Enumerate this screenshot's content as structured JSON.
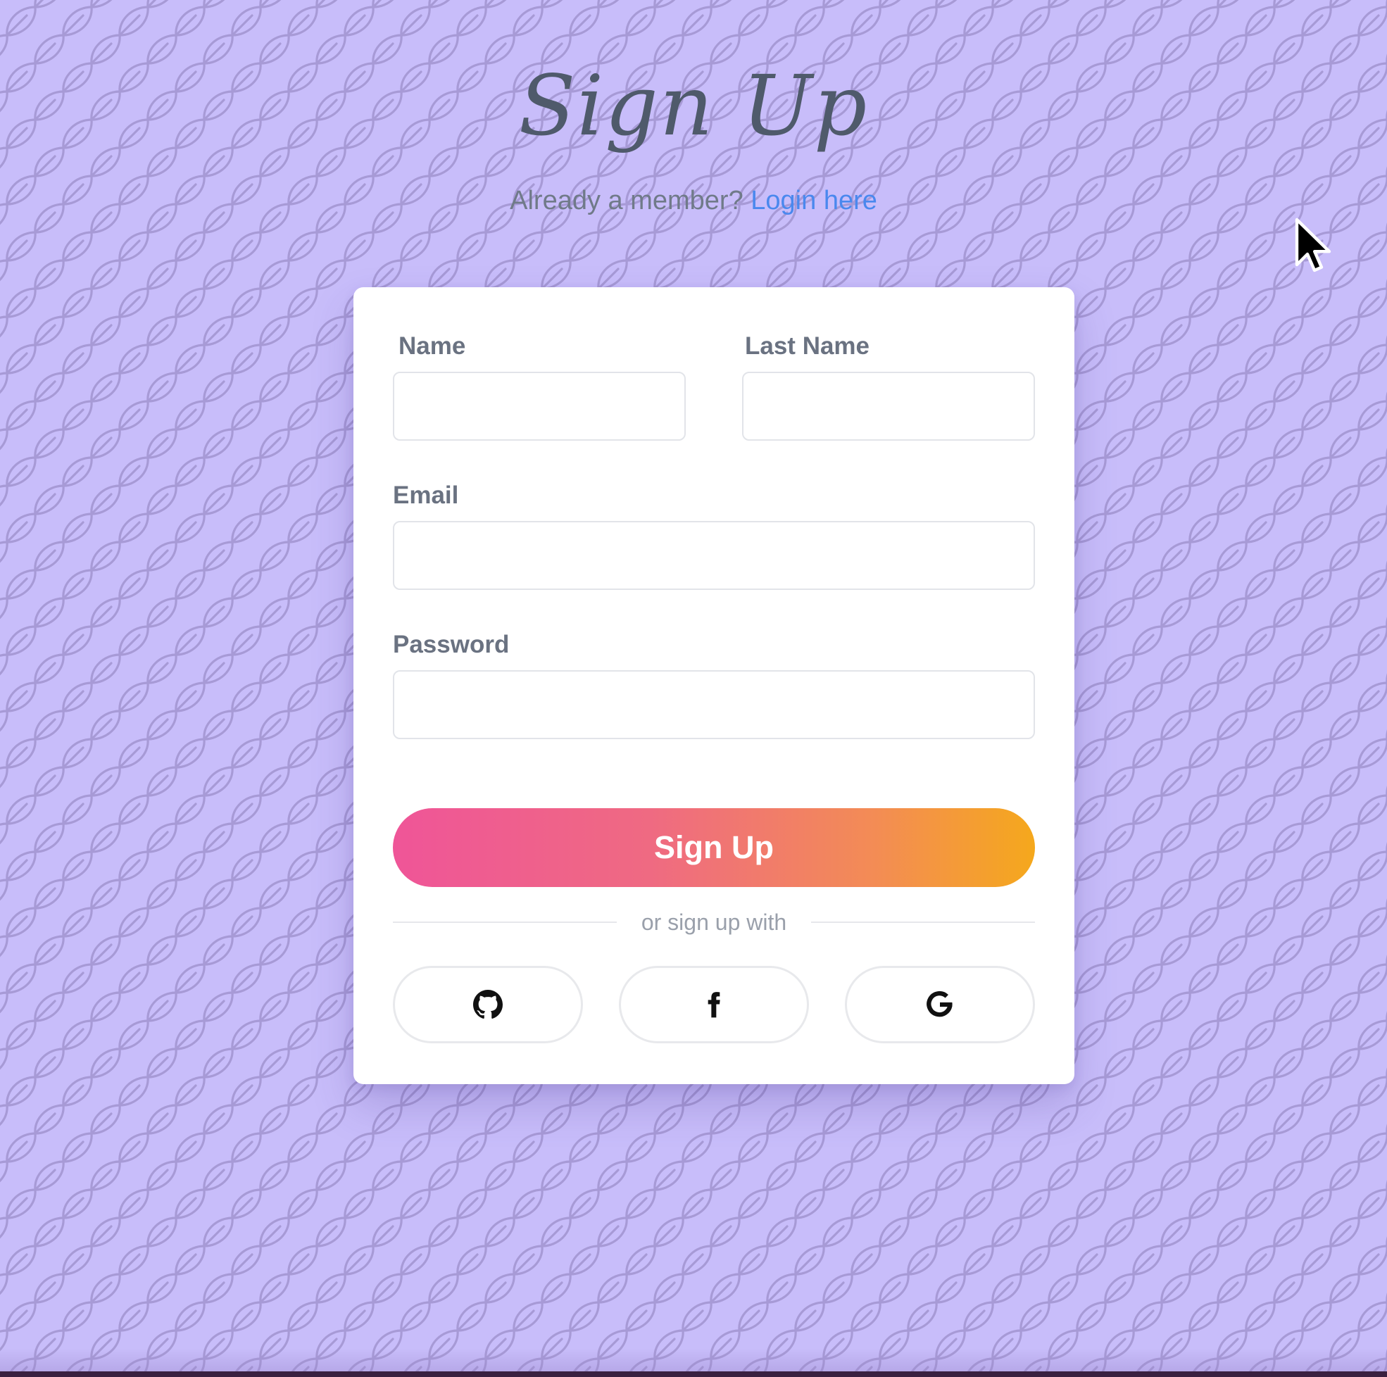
{
  "page": {
    "title": "Sign Up",
    "member_prompt": "Already a member?",
    "login_link": "Login here"
  },
  "form": {
    "name_label": "Name",
    "name_value": "",
    "last_name_label": "Last Name",
    "last_name_value": "",
    "email_label": "Email",
    "email_value": "",
    "password_label": "Password",
    "password_value": "",
    "submit_label": "Sign Up",
    "divider_text": "or sign up with"
  },
  "social": [
    {
      "icon": "github-icon"
    },
    {
      "icon": "facebook-icon"
    },
    {
      "icon": "google-icon"
    }
  ],
  "colors": {
    "background": "#c8bdfa",
    "title": "#4f5a6b",
    "link": "#4a88ee",
    "gradient_start": "#ef5598",
    "gradient_end": "#f5a81c"
  }
}
